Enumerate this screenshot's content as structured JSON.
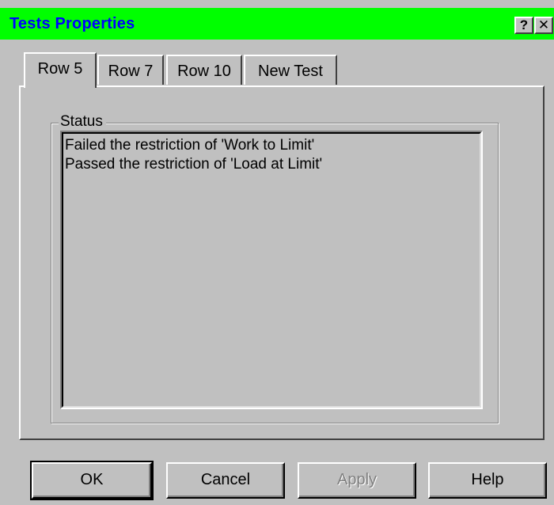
{
  "window": {
    "title": "Tests Properties",
    "help_glyph": "?",
    "close_glyph": "✕",
    "titlebar_color": "#00ff00",
    "title_color": "#0000ff"
  },
  "tabs": [
    {
      "label": "Row 5",
      "active": true
    },
    {
      "label": "Row 7",
      "active": false
    },
    {
      "label": "Row 10",
      "active": false
    },
    {
      "label": "New Test",
      "active": false
    }
  ],
  "status_group": {
    "label": "Status",
    "lines": [
      "Failed the restriction of 'Work to Limit'",
      "Passed the restriction of 'Load at Limit'"
    ]
  },
  "buttons": {
    "ok": "OK",
    "cancel": "Cancel",
    "apply": "Apply",
    "help": "Help"
  }
}
